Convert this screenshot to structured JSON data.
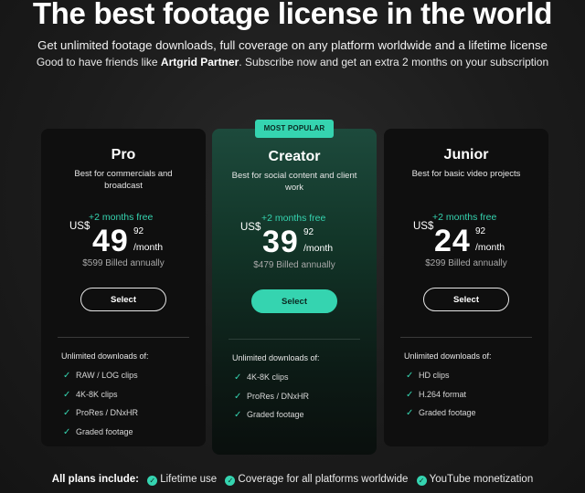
{
  "header": {
    "title": "The best footage license in the world",
    "subtitle": "Get unlimited footage downloads, full coverage on any platform worldwide and a lifetime license",
    "promo_prefix": "Good to have friends like ",
    "promo_partner": "Artgrid Partner",
    "promo_suffix": ". Subscribe now and get an extra 2 months on your subscription"
  },
  "badge": "MOST POPULAR",
  "plans": [
    {
      "name": "Pro",
      "desc": "Best for commercials and broadcast",
      "free": "+2 months free",
      "currency": "US$",
      "price": "49",
      "cents": "92",
      "period": "/month",
      "billed": "$599 Billed annually",
      "button": "Select",
      "features_head": "Unlimited downloads of:",
      "features": [
        "RAW / LOG clips",
        "4K-8K clips",
        "ProRes / DNxHR",
        "Graded footage"
      ]
    },
    {
      "name": "Creator",
      "desc": "Best for social content and client work",
      "free": "+2 months free",
      "currency": "US$",
      "price": "39",
      "cents": "92",
      "period": "/month",
      "billed": "$479 Billed annually",
      "button": "Select",
      "features_head": "Unlimited downloads of:",
      "features": [
        "4K-8K clips",
        "ProRes / DNxHR",
        "Graded footage"
      ]
    },
    {
      "name": "Junior",
      "desc": "Best for basic video projects",
      "free": "+2 months free",
      "currency": "US$",
      "price": "24",
      "cents": "92",
      "period": "/month",
      "billed": "$299 Billed annually",
      "button": "Select",
      "features_head": "Unlimited downloads of:",
      "features": [
        "HD clips",
        "H.264 format",
        "Graded footage"
      ]
    }
  ],
  "footer": {
    "label": "All plans include:",
    "items": [
      "Lifetime use",
      "Coverage for all platforms worldwide",
      "YouTube monetization"
    ]
  },
  "colors": {
    "accent": "#35d4b0",
    "card": "#0f0f0f",
    "featured_card": "#123528"
  }
}
